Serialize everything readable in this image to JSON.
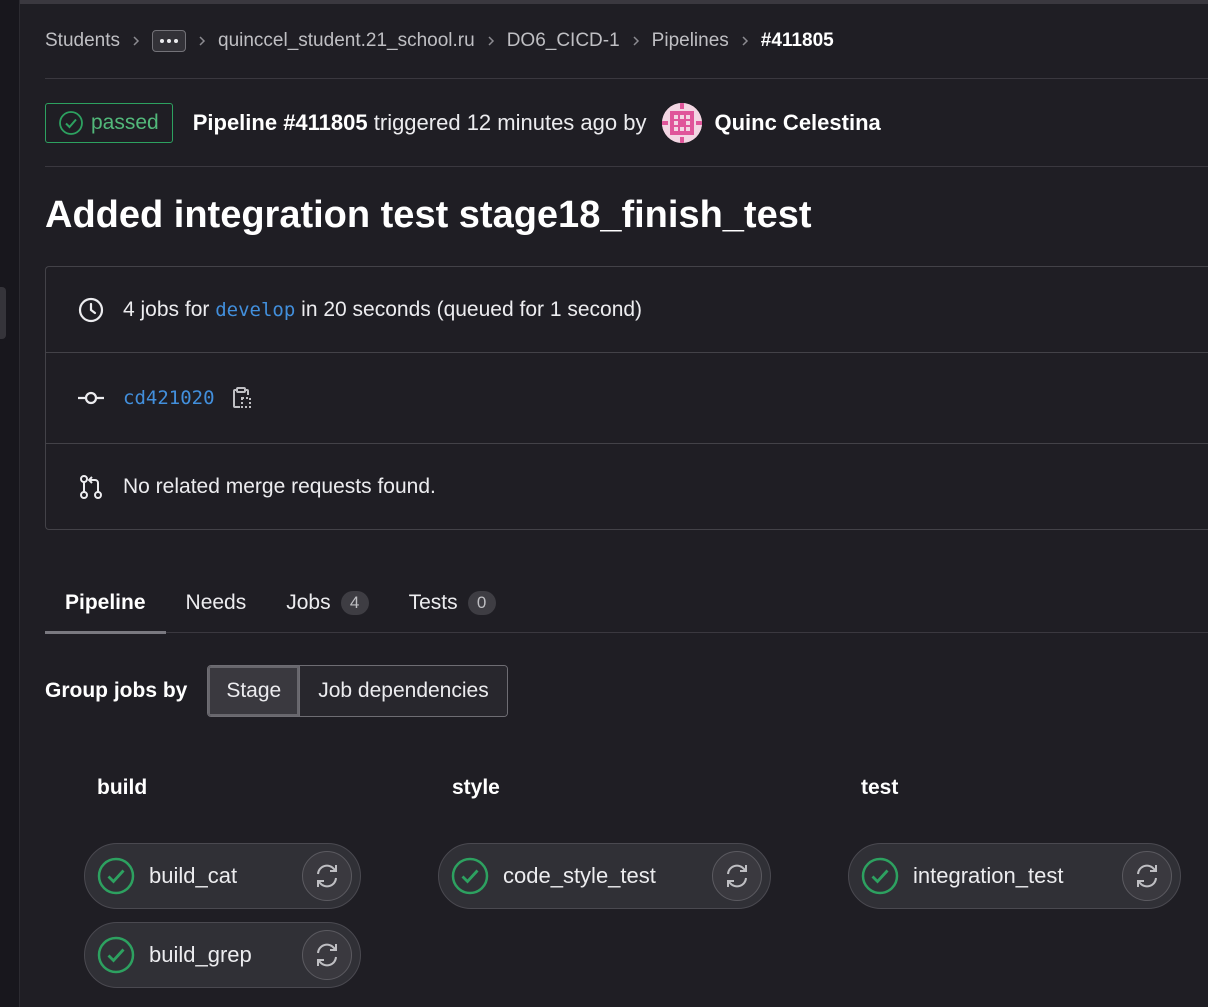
{
  "breadcrumb": {
    "items": [
      "Students",
      "quinccel_student.21_school.ru",
      "DO6_CICD-1",
      "Pipelines"
    ],
    "current": "#411805"
  },
  "header": {
    "status_label": "passed",
    "pipeline_label": "Pipeline #411805",
    "triggered_text": "triggered 12 minutes ago by",
    "author": "Quinc Celestina"
  },
  "title": "Added integration test stage18_finish_test",
  "info": {
    "jobs_prefix": "4 jobs for",
    "branch": "develop",
    "jobs_suffix": "in 20 seconds (queued for 1 second)",
    "commit_sha": "cd421020",
    "merge_requests": "No related merge requests found."
  },
  "tabs": [
    {
      "label": "Pipeline",
      "count": null
    },
    {
      "label": "Needs",
      "count": null
    },
    {
      "label": "Jobs",
      "count": "4"
    },
    {
      "label": "Tests",
      "count": "0"
    }
  ],
  "group_by": {
    "label": "Group jobs by",
    "options": [
      "Stage",
      "Job dependencies"
    ],
    "selected": "Stage"
  },
  "stages": [
    {
      "name": "build",
      "jobs": [
        "build_cat",
        "build_grep"
      ]
    },
    {
      "name": "style",
      "jobs": [
        "code_style_test"
      ]
    },
    {
      "name": "test",
      "jobs": [
        "integration_test"
      ]
    }
  ],
  "colors": {
    "success": "#2da160",
    "link": "#428fdc",
    "background": "#1f1e24"
  }
}
